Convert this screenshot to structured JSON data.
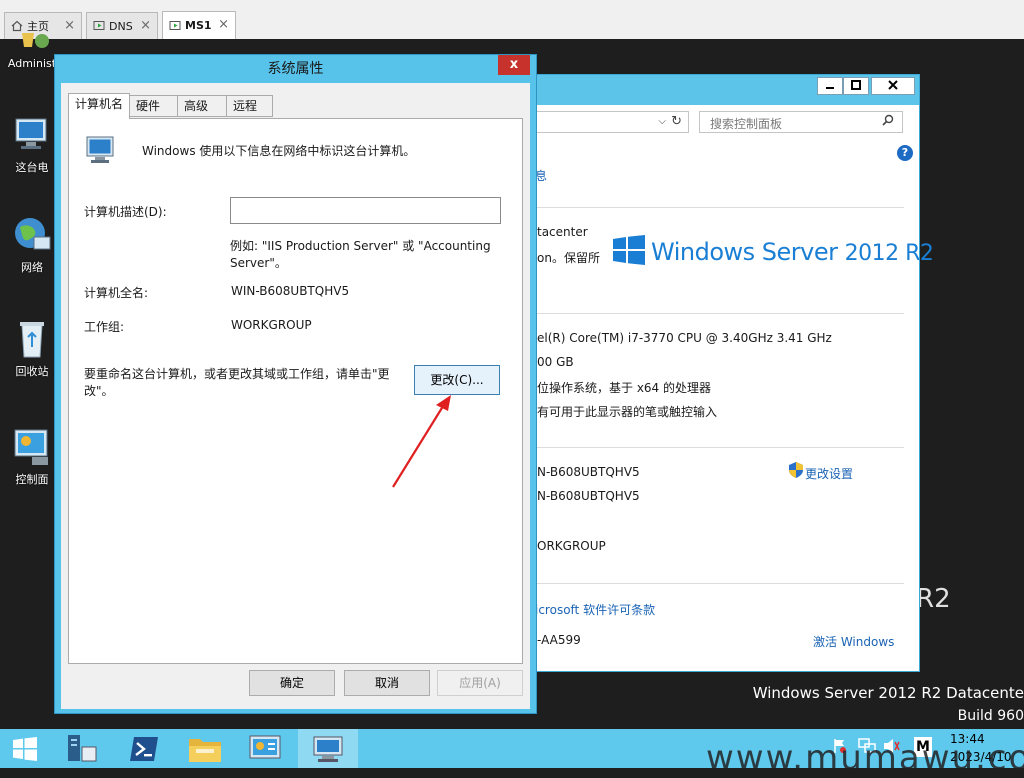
{
  "browser_tabs": [
    {
      "label": "主页",
      "icon": "home-icon"
    },
    {
      "label": "DNS",
      "icon": "vm-icon"
    },
    {
      "label": "MS1",
      "icon": "vm-icon",
      "active": true
    }
  ],
  "desktop": {
    "icons": [
      {
        "label": "Administ",
        "icon": "user-folder-icon"
      },
      {
        "label": "这台电",
        "icon": "computer-icon"
      },
      {
        "label": "网络",
        "icon": "network-icon"
      },
      {
        "label": "回收站",
        "icon": "recycle-bin-icon"
      },
      {
        "label": "控制面",
        "icon": "control-panel-icon"
      }
    ],
    "os_label": "Windows Server 2012 R2 Datacente",
    "build_label": "Build 960",
    "r2_fragment": "R2"
  },
  "control_panel": {
    "search_placeholder": "搜索控制面板",
    "fragment_link": "息",
    "edition_fragment": "tacenter",
    "copyright_fragment": "on。保留所",
    "logo_text": "Windows Server",
    "logo_version": "2012 R2",
    "processor": "el(R) Core(TM) i7-3770 CPU @ 3.40GHz   3.41 GHz",
    "memory": "00 GB",
    "system_type": "位操作系统，基于 x64 的处理器",
    "pen_touch": "有可用于此显示器的笔或触控输入",
    "computer_name": "N-B608UBTQHV5",
    "full_name": "N-B608UBTQHV5",
    "change_settings": "更改设置",
    "workgroup": "ORKGROUP",
    "license_link": "icrosoft 软件许可条款",
    "product_id": "-AA599",
    "activate_link": "激活 Windows"
  },
  "dialog": {
    "title": "系统属性",
    "close_label": "x",
    "tabs": [
      "计算机名",
      "硬件",
      "高级",
      "远程"
    ],
    "intro": "Windows 使用以下信息在网络中标识这台计算机。",
    "desc_label": "计算机描述(D):",
    "desc_value": "",
    "example_line1": "例如: \"IIS Production Server\" 或 \"Accounting",
    "example_line2": "Server\"。",
    "full_name_label": "计算机全名:",
    "full_name_value": "WIN-B608UBTQHV5",
    "workgroup_label": "工作组:",
    "workgroup_value": "WORKGROUP",
    "rename_line1": "要重命名这台计算机，或者更改其域或工作组，请单击\"更",
    "rename_line2": "改\"。",
    "change_button": "更改(C)...",
    "ok_button": "确定",
    "cancel_button": "取消",
    "apply_button": "应用(A)"
  },
  "taskbar": {
    "items": [
      "start-icon",
      "server-manager-icon",
      "powershell-icon",
      "file-explorer-icon",
      "control-panel-icon",
      "system-properties-icon"
    ],
    "time": "13:44",
    "date": "2023/4/10",
    "tray_letter": "M"
  },
  "watermark": "www.mumawu.com"
}
